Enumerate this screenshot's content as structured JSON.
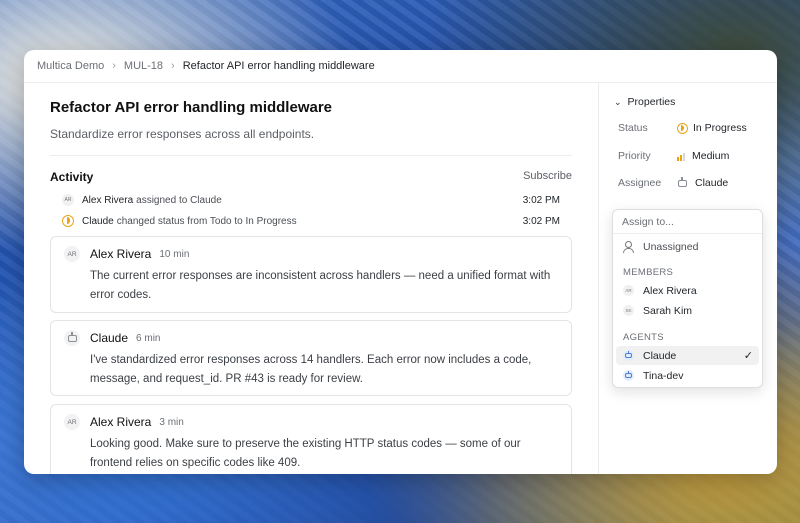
{
  "breadcrumb": {
    "workspace": "Multica Demo",
    "issue_id": "MUL-18",
    "issue_title": "Refactor API error handling middleware",
    "separator": "›"
  },
  "issue": {
    "title": "Refactor API error handling middleware",
    "description": "Standardize error responses across all endpoints."
  },
  "activity": {
    "heading": "Activity",
    "subscribe_label": "Subscribe",
    "events": [
      {
        "avatar": "AR",
        "actor": "Alex Rivera",
        "text": "assigned to Claude",
        "time": "3:02 PM"
      },
      {
        "actor": "Claude",
        "text": "changed status from Todo to In Progress",
        "time": "3:02 PM"
      }
    ],
    "comments": [
      {
        "avatar": "AR",
        "author": "Alex Rivera",
        "time": "10 min",
        "body": "The current error responses are inconsistent across handlers — need a unified format with error codes."
      },
      {
        "author": "Claude",
        "time": "6 min",
        "body": "I've standardized error responses across 14 handlers. Each error now includes a code, message, and request_id. PR #43 is ready for review."
      },
      {
        "avatar": "AR",
        "author": "Alex Rivera",
        "time": "3 min",
        "body": "Looking good. Make sure to preserve the existing HTTP status codes — some of our frontend relies on specific codes like 409."
      }
    ]
  },
  "properties": {
    "heading": "Properties",
    "status": {
      "label": "Status",
      "value": "In Progress"
    },
    "priority": {
      "label": "Priority",
      "value": "Medium",
      "level_of_4": 2
    },
    "assignee": {
      "label": "Assignee",
      "value": "Claude"
    }
  },
  "assign_menu": {
    "placeholder": "Assign to...",
    "unassigned": "Unassigned",
    "members_heading": "MEMBERS",
    "members": [
      {
        "initials": "AR",
        "name": "Alex Rivera"
      },
      {
        "initials": "SK",
        "name": "Sarah Kim"
      }
    ],
    "agents_heading": "AGENTS",
    "agents": [
      {
        "name": "Claude",
        "selected": true,
        "check": "✓"
      },
      {
        "name": "Tina-dev",
        "selected": false
      }
    ]
  },
  "colors": {
    "accent_in_progress": "#e8a317",
    "agent_icon": "#4d7fd6",
    "selected_row": "#f1f1f1"
  }
}
